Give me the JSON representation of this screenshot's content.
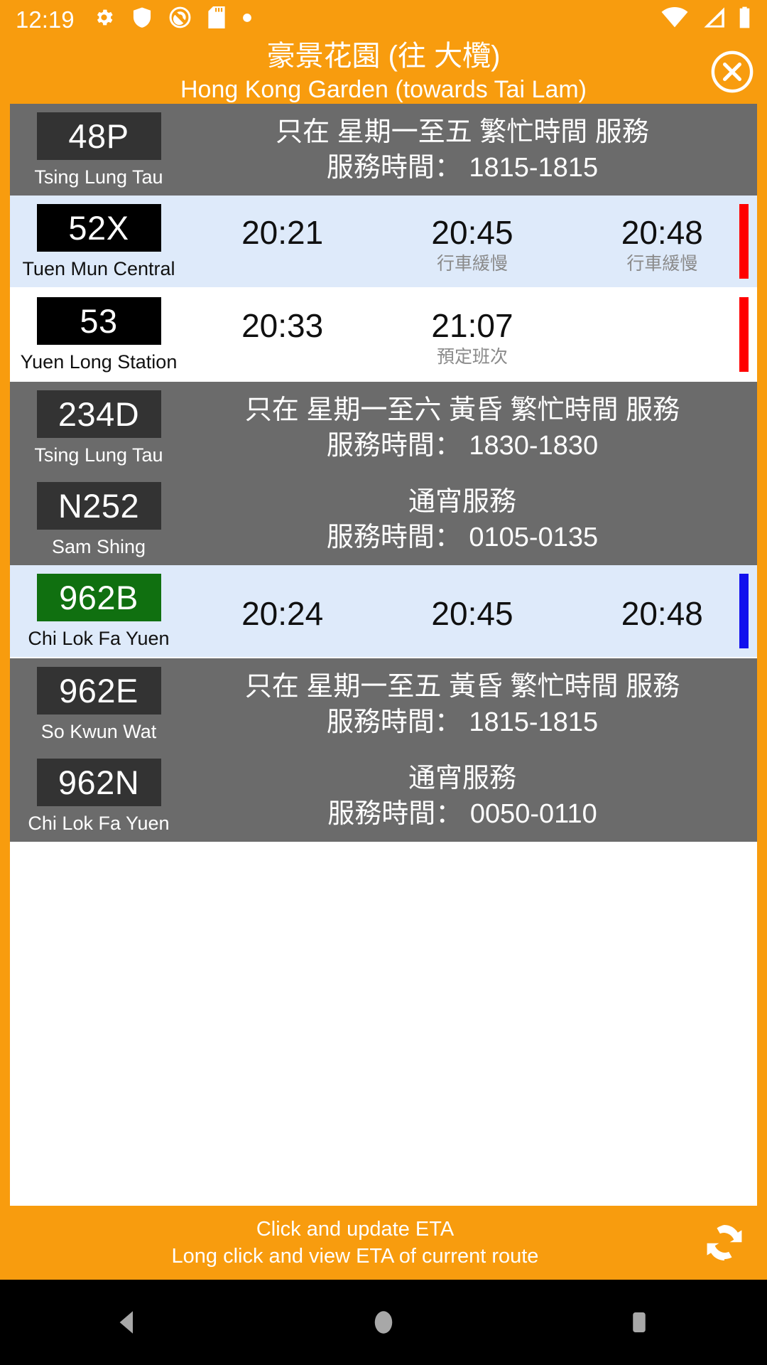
{
  "status_bar": {
    "clock": "12:19",
    "left_icons": [
      "gear-icon",
      "shield-icon",
      "adblock-icon",
      "sd-card-icon",
      "dot-icon"
    ],
    "right_icons": [
      "wifi-icon",
      "signal-icon",
      "battery-icon"
    ]
  },
  "header": {
    "title_zh": "豪景花園 (往 大欖)",
    "title_en": "Hong Kong Garden (towards Tai Lam)",
    "close_icon": "close-circle-icon",
    "background_color": "#F89C0E"
  },
  "rows": [
    {
      "route": "48P",
      "badge_style": "muted",
      "destination": "Tsing Lung Tau",
      "kind": "info",
      "row_style": "inactive",
      "info_line1": "只在 星期一至五 繁忙時間 服務",
      "info_line2": "服務時間： 1815-1815"
    },
    {
      "route": "52X",
      "badge_style": "dark",
      "destination": "Tuen Mun Central",
      "kind": "eta",
      "row_style": "eta-alt",
      "side_bar": "red",
      "etas": [
        {
          "time": "20:21",
          "note": ""
        },
        {
          "time": "20:45",
          "note": "行車緩慢"
        },
        {
          "time": "20:48",
          "note": "行車緩慢"
        }
      ]
    },
    {
      "route": "53",
      "badge_style": "dark",
      "destination": "Yuen Long Station",
      "kind": "eta",
      "row_style": "eta-white",
      "side_bar": "red",
      "etas": [
        {
          "time": "20:33",
          "note": ""
        },
        {
          "time": "21:07",
          "note": "預定班次"
        },
        {
          "time": "",
          "note": ""
        }
      ]
    },
    {
      "route": "234D",
      "badge_style": "muted",
      "destination": "Tsing Lung Tau",
      "kind": "info",
      "row_style": "inactive",
      "info_line1": "只在 星期一至六 黃昏 繁忙時間 服務",
      "info_line2": "服務時間： 1830-1830"
    },
    {
      "route": "N252",
      "badge_style": "muted",
      "destination": "Sam Shing",
      "kind": "info",
      "row_style": "inactive",
      "info_line1": "通宵服務",
      "info_line2": "服務時間： 0105-0135"
    },
    {
      "route": "962B",
      "badge_style": "green",
      "destination": "Chi Lok Fa Yuen",
      "kind": "eta",
      "row_style": "eta-alt",
      "side_bar": "blue",
      "etas": [
        {
          "time": "20:24",
          "note": ""
        },
        {
          "time": "20:45",
          "note": ""
        },
        {
          "time": "20:48",
          "note": ""
        }
      ]
    },
    {
      "route": "962E",
      "badge_style": "muted",
      "destination": "So Kwun Wat",
      "kind": "info",
      "row_style": "inactive",
      "info_line1": "只在 星期一至五 黃昏 繁忙時間 服務",
      "info_line2": "服務時間： 1815-1815"
    },
    {
      "route": "962N",
      "badge_style": "muted",
      "destination": "Chi Lok Fa Yuen",
      "kind": "info",
      "row_style": "inactive",
      "info_line1": "通宵服務",
      "info_line2": "服務時間： 0050-0110"
    }
  ],
  "bottom_bar": {
    "line1": "Click and update ETA",
    "line2": "Long click and view ETA of current route",
    "refresh_icon": "refresh-icon"
  },
  "nav_bar": {
    "back_icon": "back-triangle-icon",
    "home_icon": "home-circle-icon",
    "recents_icon": "recents-square-icon"
  },
  "colors": {
    "accent": "#F89C0E",
    "inactive_row": "#6B6B6B",
    "eta_row_alt": "#DEEAFA",
    "eta_row": "#FFFFFF",
    "badge_dark": "#000000",
    "badge_muted": "#333333",
    "badge_green": "#107010",
    "bar_red": "#FF0000",
    "bar_blue": "#1111EE"
  }
}
